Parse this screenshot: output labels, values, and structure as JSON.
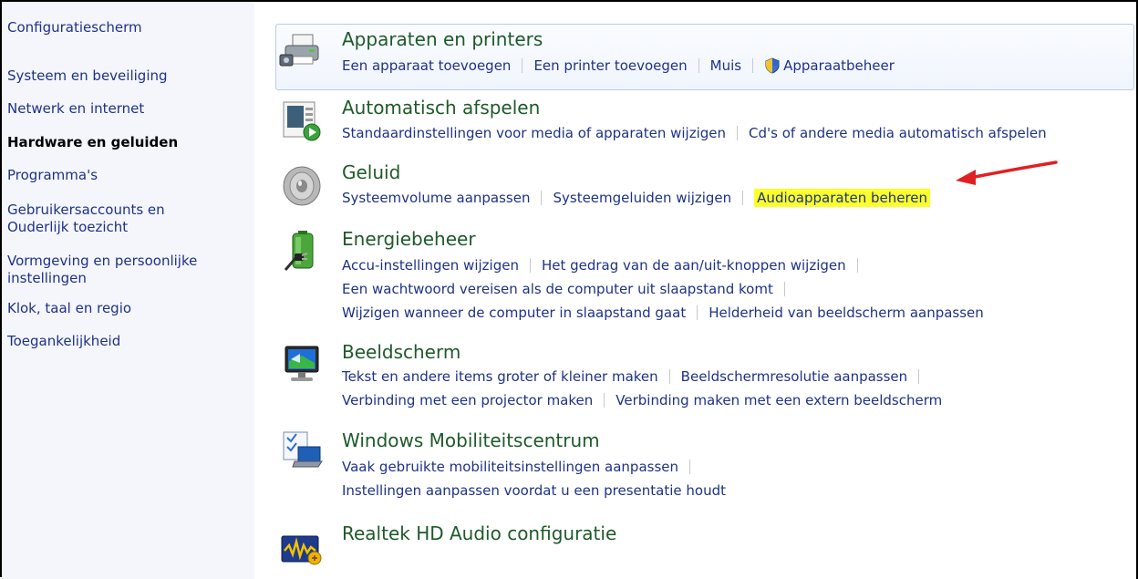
{
  "sidebar": {
    "home": "Configuratiescherm",
    "items": [
      "Systeem en beveiliging",
      "Netwerk en internet",
      "Hardware en geluiden",
      "Programma's",
      "Gebruikersaccounts en",
      "Ouderlijk toezicht",
      "Vormgeving en persoonlijke",
      "instellingen",
      "Klok, taal en regio",
      "Toegankelijkheid"
    ]
  },
  "categories": {
    "devices": {
      "title": "Apparaten en printers",
      "links": [
        "Een apparaat toevoegen",
        "Een printer toevoegen",
        "Muis",
        "Apparaatbeheer"
      ]
    },
    "autoplay": {
      "title": "Automatisch afspelen",
      "links": [
        "Standaardinstellingen voor media of apparaten wijzigen",
        "Cd's of andere media automatisch afspelen"
      ]
    },
    "sound": {
      "title": "Geluid",
      "links": [
        "Systeemvolume aanpassen",
        "Systeemgeluiden wijzigen",
        "Audioapparaten beheren"
      ]
    },
    "power": {
      "title": "Energiebeheer",
      "links": [
        "Accu-instellingen wijzigen",
        "Het gedrag van de aan/uit-knoppen wijzigen",
        "Een wachtwoord vereisen als de computer uit slaapstand komt",
        "Wijzigen wanneer de computer in slaapstand gaat",
        "Helderheid van beeldscherm aanpassen"
      ]
    },
    "display": {
      "title": "Beeldscherm",
      "links": [
        "Tekst en andere items groter of kleiner maken",
        "Beeldschermresolutie aanpassen",
        "Verbinding met een projector maken",
        "Verbinding maken met een extern beeldscherm"
      ]
    },
    "mobility": {
      "title": "Windows Mobiliteitscentrum",
      "links": [
        "Vaak gebruikte mobiliteitsinstellingen aanpassen",
        "Instellingen aanpassen voordat u een presentatie houdt"
      ]
    },
    "realtek": {
      "title": "Realtek HD Audio configuratie"
    }
  },
  "colors": {
    "link": "#1e3287",
    "title": "#1e5a29",
    "highlight": "#fbff2a",
    "arrow": "#e02020",
    "sidebar_bg": "#f4f6fc"
  },
  "icons": [
    "devices-printer-icon",
    "autoplay-icon",
    "speaker-icon",
    "battery-plug-icon",
    "monitor-icon",
    "mobility-center-icon",
    "realtek-audio-icon",
    "uac-shield-icon",
    "annotation-arrow"
  ]
}
